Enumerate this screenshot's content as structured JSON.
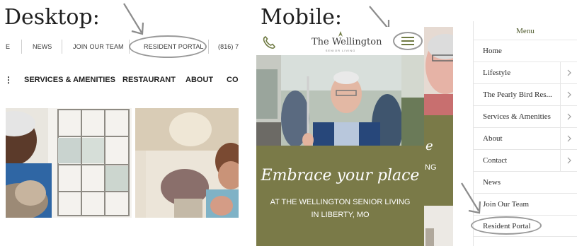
{
  "headings": {
    "desktop": "Desktop:",
    "mobile": "Mobile:"
  },
  "desktop": {
    "top_links": [
      "E",
      "NEWS",
      "JOIN OUR TEAM",
      "RESIDENT PORTAL",
      "(816) 7"
    ],
    "nav_links": [
      "SERVICES & AMENITIES",
      "RESTAURANT",
      "ABOUT",
      "CO"
    ]
  },
  "mobile": {
    "logo": "The Wellington",
    "logo_sub": "SENIOR LIVING",
    "tagline": "Embrace your place",
    "subtitle_line1": "AT THE WELLINGTON SENIOR LIVING",
    "subtitle_line2": "IN LIBERTY, MO",
    "peek_text1": "e",
    "peek_text2": "NG"
  },
  "menu": {
    "title": "Menu",
    "items": [
      {
        "label": "Home",
        "has_children": false
      },
      {
        "label": "Lifestyle",
        "has_children": true
      },
      {
        "label": "The Pearly Bird Res...",
        "has_children": true
      },
      {
        "label": "Services & Amenities",
        "has_children": true
      },
      {
        "label": "About",
        "has_children": true
      },
      {
        "label": "Contact",
        "has_children": true
      },
      {
        "label": "News",
        "has_children": false
      },
      {
        "label": "Join Our Team",
        "has_children": false
      },
      {
        "label": "Resident Portal",
        "has_children": false
      }
    ]
  },
  "colors": {
    "accent_green": "#7a7a48",
    "menu_title": "#4f5a2c",
    "annotation_gray": "#9a9a9a"
  },
  "icons": [
    "phone-icon",
    "hamburger-icon",
    "chevron-right-icon",
    "annotation-arrow-icon"
  ]
}
